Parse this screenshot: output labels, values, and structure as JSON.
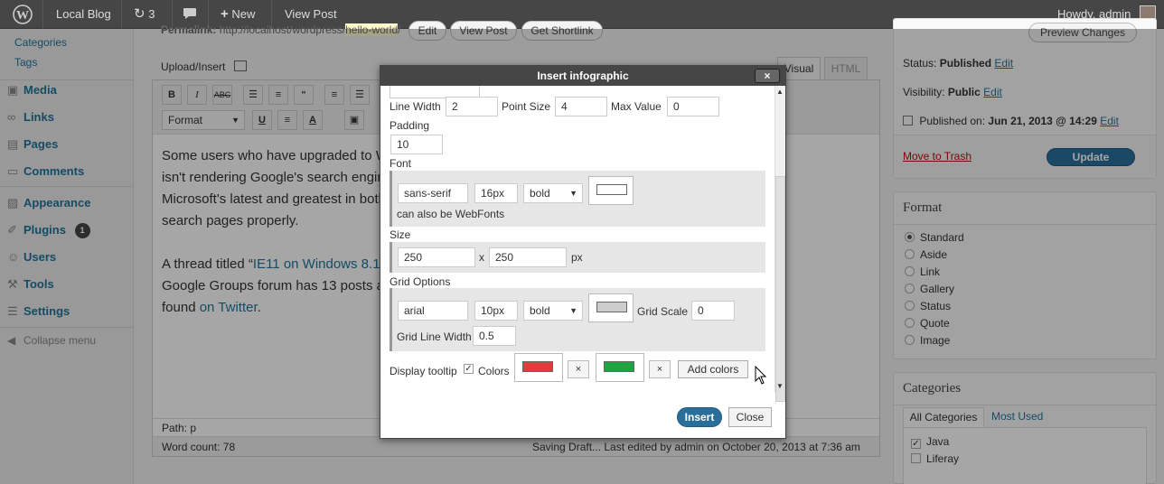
{
  "adminbar": {
    "site_name": "Local Blog",
    "updates_count": "3",
    "new_label": "New",
    "view_post_label": "View Post",
    "howdy": "Howdy, admin"
  },
  "menu": {
    "sub_items": [
      "Categories",
      "Tags"
    ],
    "items": [
      "Media",
      "Links",
      "Pages",
      "Comments",
      "Appearance",
      "Plugins",
      "Users",
      "Tools",
      "Settings"
    ],
    "plugins_badge": "1",
    "collapse": "Collapse menu"
  },
  "editor": {
    "permalink_label": "Permalink:",
    "permalink_url": "http://localhost/wordpress/",
    "permalink_slug": "hello-world",
    "edit_btn": "Edit",
    "view_post_btn": "View Post",
    "shortlink_btn": "Get Shortlink",
    "upload_insert": "Upload/Insert",
    "tab_visual": "Visual",
    "tab_html": "HTML",
    "format_select": "Format",
    "para1_a": "Some users who have upgraded to W",
    "para1_b": "isn't rendering Google's search engin",
    "para1_c": "Microsoft's latest and greatest in both",
    "para1_d": "search pages properly.",
    "para2_a": "A thread titled “",
    "para2_link": "IE11 on Windows 8.1",
    "para2_b": "Google Groups forum has 13 posts a",
    "para2_c": "found ",
    "para2_twitter": "on Twitter",
    "para2_end": ".",
    "path": "Path: p",
    "word_count": "Word count: 78",
    "status_line": "Saving Draft... Last edited by admin on October 20, 2013 at 7:36 am"
  },
  "publish": {
    "preview_btn": "Preview Changes",
    "status_label": "Status:",
    "status_value": "Published",
    "visibility_label": "Visibility:",
    "visibility_value": "Public",
    "published_on_label": "Published on:",
    "published_on_value": "Jun 21, 2013 @ 14:29",
    "edit_link": "Edit",
    "trash": "Move to Trash",
    "update_btn": "Update"
  },
  "format_box": {
    "title": "Format",
    "options": [
      "Standard",
      "Aside",
      "Link",
      "Gallery",
      "Status",
      "Quote",
      "Image"
    ],
    "selected": "Standard"
  },
  "categories_box": {
    "title": "Categories",
    "tab_all": "All Categories",
    "tab_most_used": "Most Used",
    "items": [
      {
        "label": "Java",
        "checked": true
      },
      {
        "label": "Liferay",
        "checked": false
      }
    ]
  },
  "modal": {
    "title": "Insert infographic",
    "close_symbol": "×",
    "line_width_label": "Line Width",
    "line_width": "2",
    "point_size_label": "Point Size",
    "point_size": "4",
    "max_value_label": "Max Value",
    "max_value": "0",
    "padding_label": "Padding",
    "padding": "10",
    "font_label": "Font",
    "font_family": "sans-serif",
    "font_size": "16px",
    "font_weight": "bold",
    "font_color": "#ffffff",
    "webfonts_note": "can also be WebFonts",
    "size_label": "Size",
    "width": "250",
    "height": "250",
    "x_sep": "x",
    "px_unit": "px",
    "grid_label": "Grid Options",
    "grid_font": "arial",
    "grid_size": "10px",
    "grid_weight": "bold",
    "grid_color": "#cccccc",
    "grid_scale_label": "Grid Scale",
    "grid_scale": "0",
    "grid_line_width_label": "Grid Line Width",
    "grid_line_width": "0.5",
    "tooltip_label": "Display tooltip",
    "colors_label": "Colors",
    "color1": "#dd3d3d",
    "color2": "#1fa53f",
    "remove_symbol": "×",
    "add_colors_btn": "Add colors",
    "insert_btn": "Insert",
    "close_btn": "Close"
  }
}
